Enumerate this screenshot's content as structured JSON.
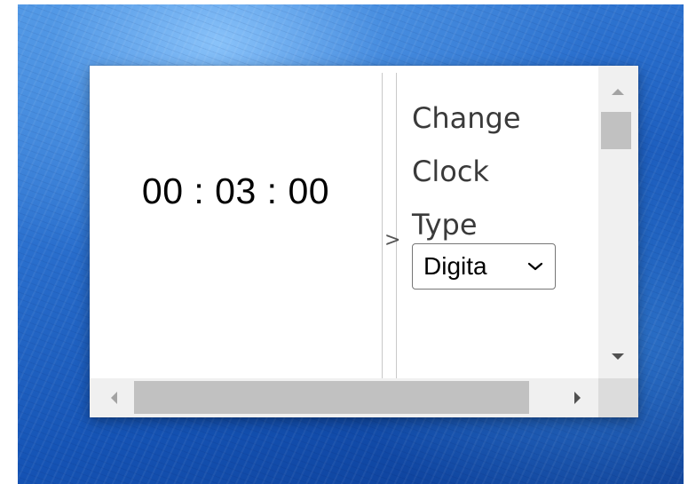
{
  "clock": {
    "time": "00 : 03 : 00"
  },
  "splitter": {
    "arrow": ">"
  },
  "settings": {
    "label_lines": [
      "Change",
      "Clock",
      "Type"
    ],
    "clock_type_selected": "Digital",
    "clock_type_visible_text": "Digita"
  },
  "scrollbars": {
    "vertical": {
      "up_icon": "arrow-up-icon",
      "down_icon": "arrow-down-icon"
    },
    "horizontal": {
      "left_icon": "arrow-left-icon",
      "right_icon": "arrow-right-icon"
    }
  },
  "colors": {
    "clock_text": "#000000",
    "label_text": "#3a3a3a",
    "scrollbar_track": "#f0f0f0",
    "scrollbar_thumb": "#c1c1c1",
    "desktop_blue": "#1553b4"
  }
}
